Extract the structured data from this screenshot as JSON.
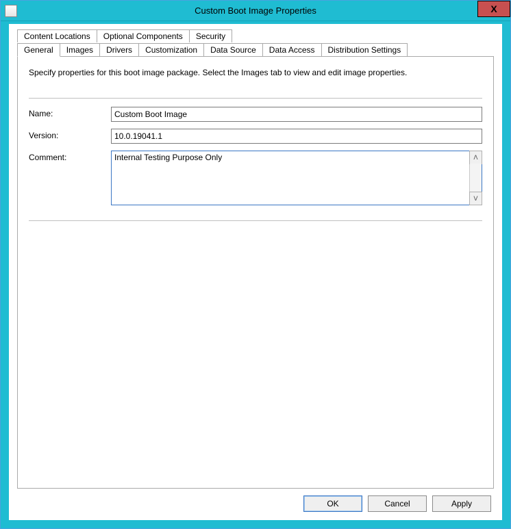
{
  "window": {
    "title": "Custom Boot Image Properties",
    "close_glyph": "X"
  },
  "tabs_row1": [
    {
      "label": "Content Locations"
    },
    {
      "label": "Optional Components"
    },
    {
      "label": "Security"
    }
  ],
  "tabs_row2": [
    {
      "label": "General"
    },
    {
      "label": "Images"
    },
    {
      "label": "Drivers"
    },
    {
      "label": "Customization"
    },
    {
      "label": "Data Source"
    },
    {
      "label": "Data Access"
    },
    {
      "label": "Distribution Settings"
    }
  ],
  "general": {
    "instruction": "Specify properties for this boot image package. Select the Images tab to view and edit image properties.",
    "name_label": "Name:",
    "name_value": "Custom Boot Image",
    "version_label": "Version:",
    "version_value": "10.0.19041.1",
    "comment_label": "Comment:",
    "comment_value": "Internal Testing Purpose Only"
  },
  "buttons": {
    "ok": "OK",
    "cancel": "Cancel",
    "apply": "Apply"
  },
  "glyphs": {
    "up": "ᐱ",
    "down": "ᐯ"
  }
}
